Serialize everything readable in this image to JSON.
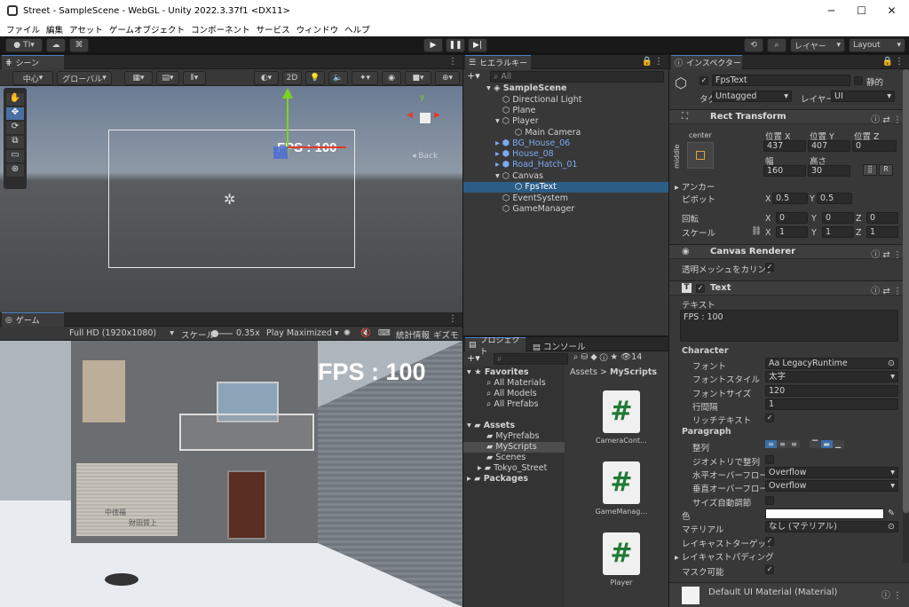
{
  "window": {
    "title": "Street - SampleScene - WebGL - Unity 2022.3.37f1 <DX11>"
  },
  "menu": [
    "ファイル",
    "編集",
    "アセット",
    "ゲームオブジェクト",
    "コンポーネント",
    "サービス",
    "ウィンドウ",
    "ヘルプ"
  ],
  "toolbar": {
    "account": "TI",
    "layer": "レイヤー",
    "layout": "Layout"
  },
  "scene": {
    "tab": "シーン",
    "pivot": "中心",
    "global": "グローバル",
    "mode2d": "2D",
    "fps_overlay": "FPS : 100",
    "back": "Back"
  },
  "game": {
    "tab": "ゲーム",
    "resolution": "Full HD (1920x1080)",
    "scale_label": "スケール",
    "scale_value": "0.35x",
    "play_mode": "Play Maximized",
    "stats": "統計情報",
    "gizmos": "ギズモ",
    "fps_text": "FPS : 100",
    "sign1": "中徳福",
    "sign2": "財田質上"
  },
  "hierarchy": {
    "tab": "ヒエラルキー",
    "search_placeholder": "All",
    "scene": "SampleScene",
    "items": [
      "Directional Light",
      "Plane",
      "Player",
      "Main Camera",
      "BG_House_06",
      "House_08",
      "Road_Hatch_01",
      "Canvas",
      "FpsText",
      "EventSystem",
      "GameManager"
    ]
  },
  "project": {
    "tab": "プロジェクト",
    "console_tab": "コンソール",
    "count": "14",
    "breadcrumb_root": "Assets",
    "breadcrumb_sep": ">",
    "breadcrumb_leaf": "MyScripts",
    "favorites": "Favorites",
    "fav_items": [
      "All Materials",
      "All Models",
      "All Prefabs"
    ],
    "assets": "Assets",
    "asset_items": [
      "MyPrefabs",
      "MyScripts",
      "Scenes",
      "Tokyo_Street"
    ],
    "packages": "Packages",
    "scripts": [
      "CameraCont…",
      "GameManag…",
      "Player"
    ]
  },
  "inspector": {
    "tab": "インスペクター",
    "object_name": "FpsText",
    "static": "静的",
    "tag_label": "タグ",
    "tag": "Untagged",
    "layer_label": "レイヤー",
    "layer": "UI",
    "rect": {
      "title": "Rect Transform",
      "center": "center",
      "middle": "middle",
      "posx_l": "位置 X",
      "posy_l": "位置 Y",
      "posz_l": "位置 Z",
      "posx": "437",
      "posy": "407",
      "posz": "0",
      "w_l": "幅",
      "h_l": "高さ",
      "w": "160",
      "h": "30",
      "r": "R",
      "anchor": "アンカー",
      "pivot": "ピボット",
      "pivx": "0.5",
      "pivy": "0.5",
      "rot": "回転",
      "rx": "0",
      "ry": "0",
      "rz": "0",
      "scale": "スケール",
      "sx": "1",
      "sy": "1",
      "sz": "1",
      "x": "X",
      "y": "Y",
      "z": "Z"
    },
    "canvas_renderer": {
      "title": "Canvas Renderer",
      "cull": "透明メッシュをカリング"
    },
    "text": {
      "title": "Text",
      "text_label": "テキスト",
      "text_value": "FPS : 100",
      "character": "Character",
      "font_l": "フォント",
      "font": "LegacyRuntime",
      "style_l": "フォントスタイル",
      "style": "太字",
      "size_l": "フォントサイズ",
      "size": "120",
      "line_l": "行間隔",
      "line": "1",
      "rich_l": "リッチテキスト",
      "paragraph": "Paragraph",
      "align_l": "整列",
      "geom_l": "ジオメトリで整列",
      "hover_l": "水平オーバーフロー",
      "hover": "Overflow",
      "vover_l": "垂直オーバーフロー",
      "vover": "Overflow",
      "best_l": "サイズ自動調節",
      "color_l": "色",
      "mat_l": "マテリアル",
      "mat": "なし (マテリアル)",
      "ray_l": "レイキャストターゲット",
      "pad_l": "レイキャストパディング",
      "mask_l": "マスク可能"
    },
    "material": "Default UI Material (Material)"
  }
}
